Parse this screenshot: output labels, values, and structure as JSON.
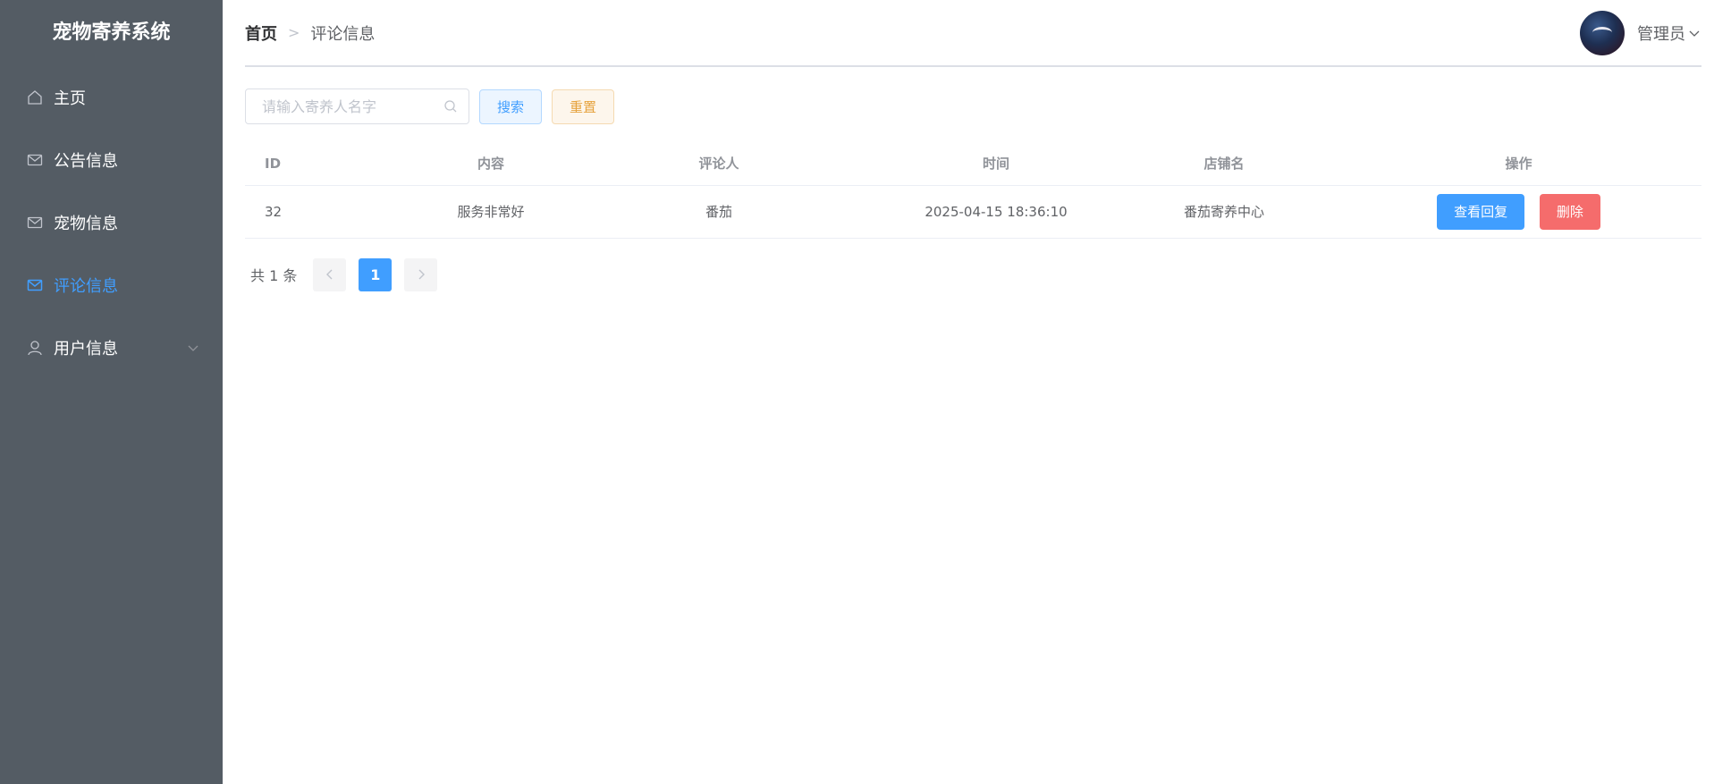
{
  "app": {
    "title": "宠物寄养系统"
  },
  "sidebar": {
    "items": [
      {
        "label": "主页",
        "icon": "home-icon",
        "active": false
      },
      {
        "label": "公告信息",
        "icon": "mail-icon",
        "active": false
      },
      {
        "label": "宠物信息",
        "icon": "mail-icon",
        "active": false
      },
      {
        "label": "评论信息",
        "icon": "mail-icon",
        "active": true
      },
      {
        "label": "用户信息",
        "icon": "user-icon",
        "active": false,
        "expandable": true
      }
    ]
  },
  "header": {
    "breadcrumb": {
      "home": "首页",
      "separator": ">",
      "current": "评论信息"
    },
    "user": {
      "name": "管理员"
    }
  },
  "toolbar": {
    "search_placeholder": "请输入寄养人名字",
    "search_value": "",
    "search_label": "搜索",
    "reset_label": "重置"
  },
  "table": {
    "columns": [
      "ID",
      "内容",
      "评论人",
      "时间",
      "店铺名",
      "操作"
    ],
    "rows": [
      {
        "id": "32",
        "content": "服务非常好",
        "reviewer": "番茄",
        "time": "2025-04-15 18:36:10",
        "shop": "番茄寄养中心",
        "view_label": "查看回复",
        "delete_label": "删除"
      }
    ]
  },
  "pagination": {
    "total_text": "共 1 条",
    "current_page": "1"
  },
  "colors": {
    "sidebar_bg": "#545c64",
    "accent": "#409eff",
    "danger": "#f56c6c",
    "warning": "#e6a23c"
  }
}
